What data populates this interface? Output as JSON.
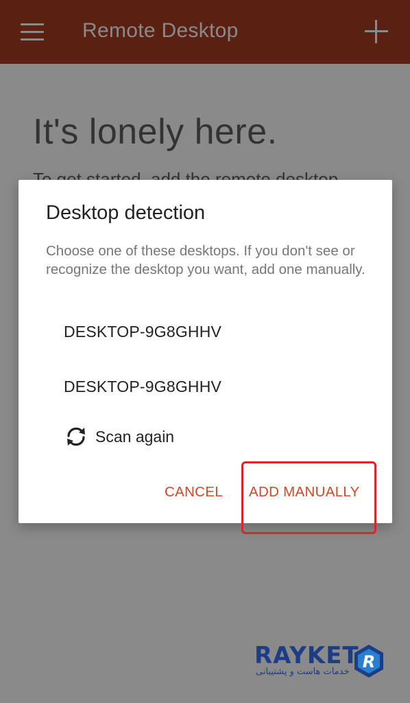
{
  "app_bar": {
    "title": "Remote Desktop",
    "menu_icon": "hamburger-menu-icon",
    "add_icon": "plus-icon"
  },
  "empty_state": {
    "heading": "It's lonely here.",
    "subtext": "To get started, add the remote desktop"
  },
  "dialog": {
    "title": "Desktop detection",
    "message": "Choose one of these desktops. If you don't see or recognize the desktop you want, add one manually.",
    "desktops": [
      "DESKTOP-9G8GHHV",
      "DESKTOP-9G8GHHV"
    ],
    "scan_label": "Scan again",
    "scan_icon": "refresh-icon",
    "cancel_label": "CANCEL",
    "add_manually_label": "ADD MANUALLY"
  },
  "watermark": {
    "brand": "RAYKET",
    "tagline": "خدمات هاست و پشتیبانی"
  },
  "colors": {
    "app_bar": "#5a2113",
    "scrim": "#8a8a8a",
    "accent": "#d24726",
    "highlight": "#e0222b",
    "brand_blue": "#1d3e86"
  }
}
